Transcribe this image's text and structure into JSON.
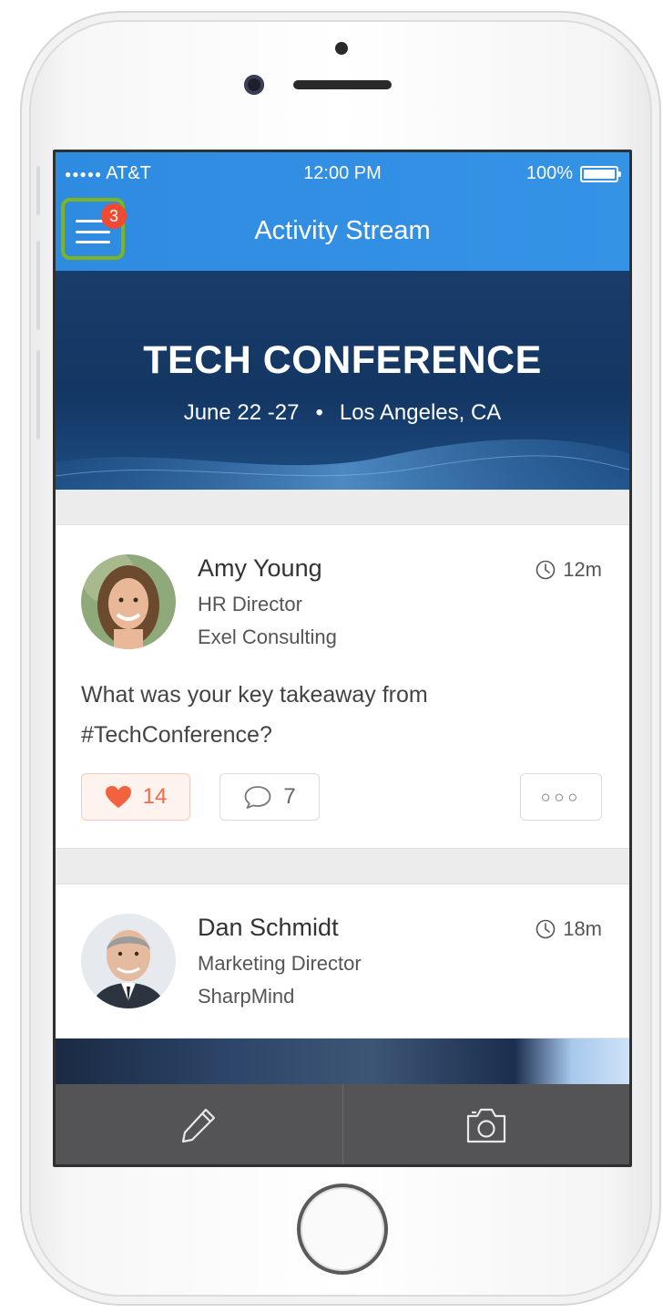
{
  "status_bar": {
    "signal": "●●●●●",
    "carrier": "AT&T",
    "time": "12:00 PM",
    "battery": "100%"
  },
  "nav": {
    "title": "Activity Stream",
    "menu_badge": "3",
    "accent": "#3593e6",
    "highlight": "#7db521"
  },
  "banner": {
    "title": "TECH CONFERENCE",
    "date": "June 22 -27",
    "separator": "•",
    "location": "Los Angeles, CA"
  },
  "posts": [
    {
      "name": "Amy Young",
      "role": "HR Director",
      "company": "Exel Consulting",
      "time": "12m",
      "text": "What was your key takeaway from #TechConference?",
      "likes": "14",
      "comments": "7",
      "more": "○○○"
    },
    {
      "name": "Dan Schmidt",
      "role": "Marketing Director",
      "company": "SharpMind",
      "time": "18m"
    }
  ],
  "toolbar": {
    "items": [
      "pencil-icon",
      "camera-icon"
    ]
  },
  "icons": {
    "clock": "clock-icon",
    "heart": "heart-icon",
    "comment": "comment-icon",
    "more": "more-icon",
    "menu": "menu-icon"
  }
}
